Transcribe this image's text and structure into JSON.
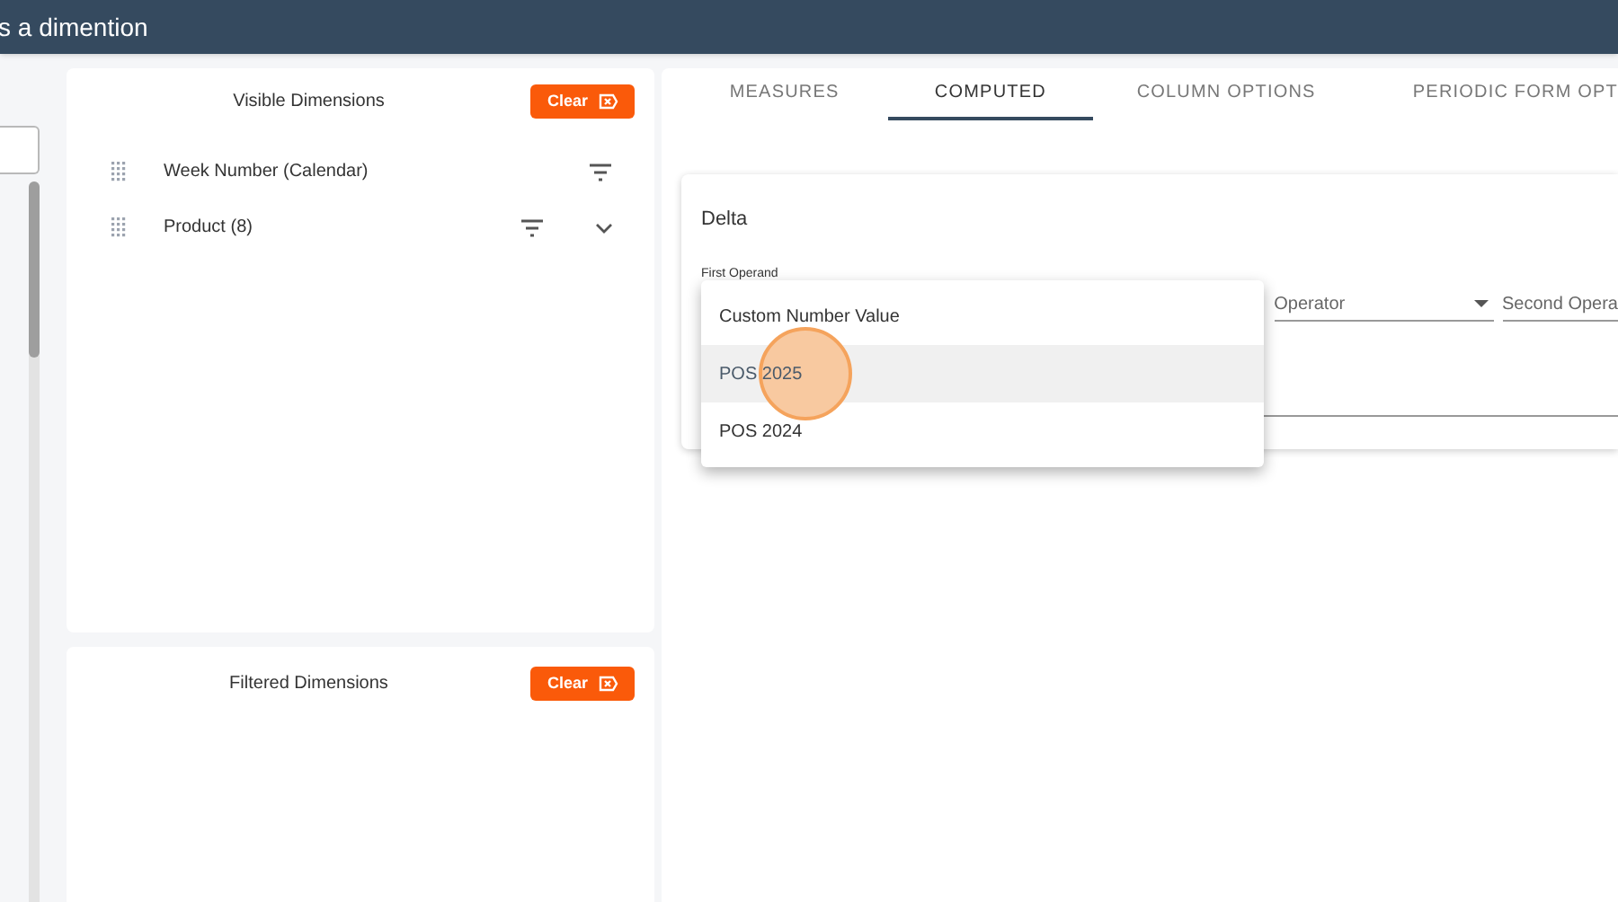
{
  "header": {
    "title": "s a dimention"
  },
  "visible_dimensions": {
    "title": "Visible Dimensions",
    "clear_label": "Clear",
    "items": [
      {
        "label": "Week Number (Calendar)",
        "expandable": false
      },
      {
        "label": "Product (8)",
        "expandable": true
      }
    ]
  },
  "filtered_dimensions": {
    "title": "Filtered Dimensions",
    "clear_label": "Clear"
  },
  "tabs": [
    {
      "label": "MEASURES",
      "selected": false
    },
    {
      "label": "COMPUTED",
      "selected": true
    },
    {
      "label": "COLUMN OPTIONS",
      "selected": false
    },
    {
      "label": "PERIODIC FORM OPT",
      "selected": false
    }
  ],
  "computed_card": {
    "title": "Delta",
    "first_operand_label": "First Operand",
    "operator_placeholder": "Operator",
    "second_operand_placeholder": "Second Opera"
  },
  "operand_menu": [
    {
      "label": "Custom Number Value",
      "selected": false
    },
    {
      "label": "POS 2025",
      "selected": true
    },
    {
      "label": "POS 2024",
      "selected": false
    }
  ]
}
